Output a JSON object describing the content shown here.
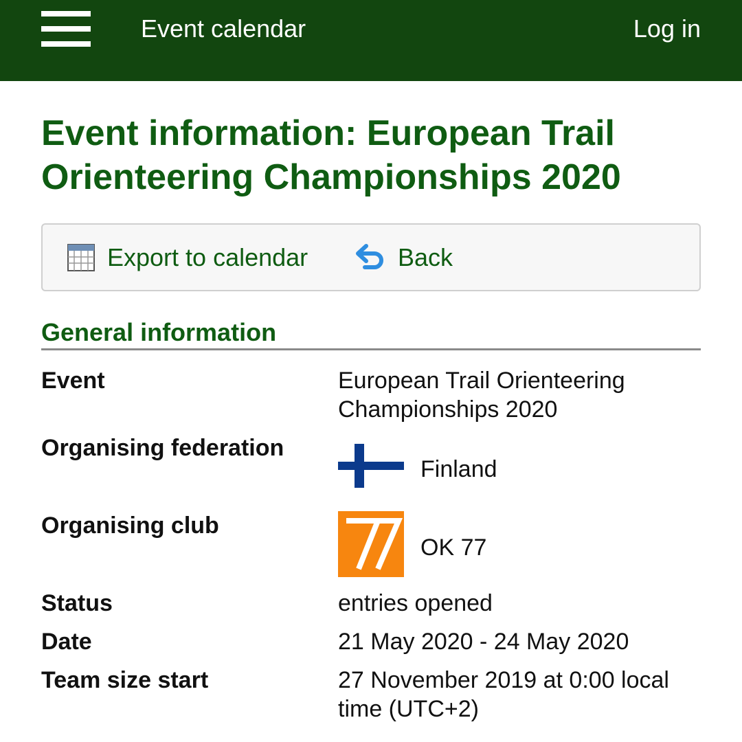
{
  "header": {
    "app_title": "Event calendar",
    "login_label": "Log in"
  },
  "page": {
    "title": "Event information: European Trail Orienteering Championships 2020"
  },
  "toolbar": {
    "export_label": "Export to calendar",
    "back_label": "Back"
  },
  "section": {
    "heading": "General information"
  },
  "details": {
    "event_label": "Event",
    "event_value": "European Trail Orienteering Championships 2020",
    "federation_label": "Organising federation",
    "federation_value": "Finland",
    "club_label": "Organising club",
    "club_value": "OK 77",
    "status_label": "Status",
    "status_value": "entries opened",
    "date_label": "Date",
    "date_value": "21 May 2020 - 24 May 2020",
    "team_size_label": "Team size start",
    "team_size_value": "27 November 2019 at 0:00 local time (UTC+2)"
  },
  "colors": {
    "header_bg": "#12460f",
    "accent": "#0f5c12",
    "flag_blue": "#0b3a8c",
    "club_orange": "#f7860f"
  },
  "icons": [
    "menu-icon",
    "calendar-icon",
    "back-arrow-icon",
    "finland-flag-icon",
    "ok77-logo"
  ]
}
